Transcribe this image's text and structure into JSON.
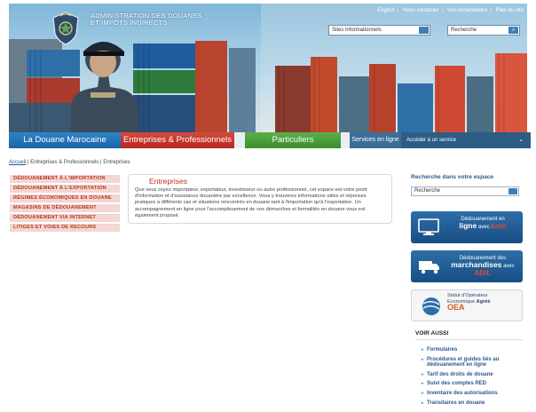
{
  "header": {
    "site_name_line1": "ADMINISTRATION DES DOUANES",
    "site_name_line2": "ET IMPÔTS INDIRECTS",
    "top_links": [
      "English",
      "Nous contacter",
      "Vos réclamations",
      "Plan du site"
    ],
    "sites_select_value": "Sites informationnels",
    "search_placeholder": "Recherche"
  },
  "nav": {
    "items": [
      "La Douane Marocaine",
      "Entreprises & Professionnels",
      "Particuliers"
    ],
    "services_label": "Services en ligne",
    "services_select": "Accéder à un service"
  },
  "breadcrumb": {
    "home": "Accueil",
    "level1": "Entreprises & Professionnels",
    "current": "Entreprises"
  },
  "left_menu": [
    "DÉDOUANEMENT À L'IMPORTATION",
    "DÉDOUANEMENT À L'EXPORTATION",
    "RÉGIMES ÉCONOMIQUES EN DOUANE",
    "MAGASINS DE DÉDOUANEMENT",
    "DÉDOUANEMENT VIA INTERNET",
    "LITIGES ET VOIES DE RECOURS"
  ],
  "content": {
    "title": "Entreprises",
    "text": "Que vous soyez importateur, exportateur, investisseur ou autre professionnel, cet espace est votre point d'information et d'assistance douanière par excellence. Vous y trouverez informations utiles et réponses pratiques à différents cas et situations rencontrés en douane tant à l'importation qu'à l'exportation. Un accompagnement en ligne pour l'accomplissement de vos démarches et formalités en douane vous est également proposé."
  },
  "right": {
    "search_title": "Recherche dans votre espace",
    "search_placeholder": "Recherche",
    "promo_badr": {
      "line1": "Dédouanement en",
      "line2": "ligne",
      "avec": "avec",
      "brand": "BADR"
    },
    "promo_adil": {
      "line1": "Dédouanement des",
      "line2": "marchandises",
      "avec": "avec",
      "brand": "ADIL"
    },
    "promo_oea": {
      "line1": "Statut d'Opérateur",
      "line2": "Economique",
      "line2b": "Agréé",
      "brand": "OEA"
    },
    "voir_aussi_title": "VOIR AUSSI",
    "voir_aussi": [
      "Formulaires",
      "Procédures et guides liés au dédouanement en ligne",
      "Tarif des droits de douane",
      "Suivi des comptes RED",
      "Inventaire des autorisations",
      "Transitaires en douane"
    ]
  },
  "colors": {
    "nav_blue": "#1d63a6",
    "nav_red": "#b5281e",
    "nav_green": "#3d8d2e",
    "menu_text": "#c0311f",
    "menu_bg": "#f2d7d2",
    "link": "#2a5a8c"
  }
}
